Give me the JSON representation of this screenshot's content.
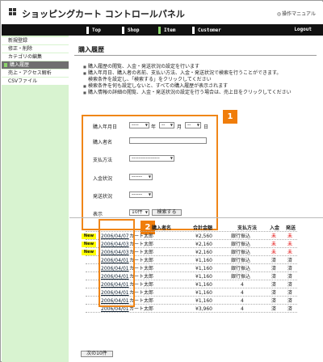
{
  "header": {
    "title": "ショッピングカート コントロールパネル",
    "manual": "操作マニュアル"
  },
  "nav": {
    "items": [
      "Top",
      "Shop",
      "Item",
      "Customer"
    ],
    "logout": "Logout"
  },
  "sidebar": {
    "items": [
      "新規登録",
      "修正・削除",
      "カテゴリの編集",
      "購入履歴",
      "売上・アクセス解析",
      "CSVファイル"
    ]
  },
  "main": {
    "title": "購入履歴",
    "notes": [
      "購入履歴の閲覧、入金・発送状況の設定を行います",
      "購入年月日、購入者の名前、支払い方法、入金・発送状況で検索を行うことができます。",
      "検索条件を設定し、「検索する」をクリックしてください",
      "検索条件を何も設定しないと、すべての購入履歴が表示されます",
      "購入情報の詳細の閲覧、入金・発送状況の設定を行う場合は、売上日をクリックしてください"
    ]
  },
  "search": {
    "date_label": "購入年月日",
    "year_value": "----",
    "year_unit": "年",
    "month_value": "--",
    "month_unit": "月",
    "day_value": "--",
    "day_unit": "日",
    "buyer_label": "購入者名",
    "payment_label": "支払方法",
    "payment_value": "----------------",
    "deposit_label": "入金状況",
    "deposit_value": "------",
    "shipping_label": "発送状況",
    "shipping_value": "------",
    "display_label": "表示",
    "display_value": "10件",
    "button": "検索する"
  },
  "badges": {
    "search": "1",
    "table": "2"
  },
  "table": {
    "headers": {
      "name": "購入者名",
      "amount": "合計金額",
      "method": "支払方法",
      "deposit": "入金",
      "shipping": "発送"
    },
    "rows": [
      {
        "new": "New",
        "date": "2006/04/07",
        "name": "カート太郎",
        "amount": "¥2,560",
        "method": "銀行振込",
        "deposit": "未",
        "shipping": "未"
      },
      {
        "new": "New",
        "date": "2006/04/03",
        "name": "カート太郎",
        "amount": "¥2,160",
        "method": "銀行振込",
        "deposit": "未",
        "shipping": "未"
      },
      {
        "new": "New",
        "date": "2006/04/03",
        "name": "カート太郎",
        "amount": "¥2,160",
        "method": "銀行振込",
        "deposit": "未",
        "shipping": "未"
      },
      {
        "new": "",
        "date": "2006/04/01",
        "name": "カート太郎",
        "amount": "¥1,160",
        "method": "銀行振込",
        "deposit": "済",
        "shipping": "済"
      },
      {
        "new": "",
        "date": "2006/04/01",
        "name": "カート太郎",
        "amount": "¥1,160",
        "method": "銀行振込",
        "deposit": "済",
        "shipping": "済"
      },
      {
        "new": "",
        "date": "2006/04/01",
        "name": "カート太郎",
        "amount": "¥1,160",
        "method": "銀行振込",
        "deposit": "済",
        "shipping": "済"
      },
      {
        "new": "",
        "date": "2006/04/01",
        "name": "カート太郎",
        "amount": "¥1,160",
        "method": "4",
        "deposit": "済",
        "shipping": "済"
      },
      {
        "new": "",
        "date": "2006/04/01",
        "name": "カート太郎",
        "amount": "¥1,160",
        "method": "4",
        "deposit": "済",
        "shipping": "済"
      },
      {
        "new": "",
        "date": "2006/04/01",
        "name": "カート太郎",
        "amount": "¥1,160",
        "method": "4",
        "deposit": "済",
        "shipping": "済"
      },
      {
        "new": "",
        "date": "2006/04/01",
        "name": "カート太郎",
        "amount": "¥3,960",
        "method": "4",
        "deposit": "済",
        "shipping": "済"
      }
    ]
  },
  "pagination": {
    "next": "次の10件"
  },
  "colors": {
    "accent": "#f08618",
    "nav_active": "#8bd46a",
    "sidebar": "#d8f3d0",
    "unpaid": "#e20000"
  }
}
